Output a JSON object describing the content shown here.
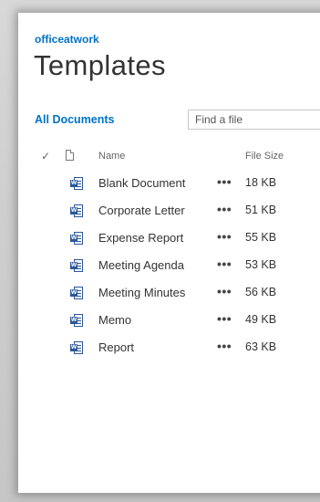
{
  "site": {
    "name": "officeatwork"
  },
  "page": {
    "title": "Templates"
  },
  "view": {
    "label": "All Documents"
  },
  "search": {
    "placeholder": "Find a file"
  },
  "columns": {
    "check": "✓",
    "type_icon": "document-icon",
    "name": "Name",
    "size": "File Size"
  },
  "row_menu_label": "•••",
  "files": [
    {
      "name": "Blank Document",
      "size": "18 KB",
      "icon": "word-icon"
    },
    {
      "name": "Corporate Letter",
      "size": "51 KB",
      "icon": "word-icon"
    },
    {
      "name": "Expense Report",
      "size": "55 KB",
      "icon": "word-icon"
    },
    {
      "name": "Meeting Agenda",
      "size": "53 KB",
      "icon": "word-icon"
    },
    {
      "name": "Meeting Minutes",
      "size": "56 KB",
      "icon": "word-icon"
    },
    {
      "name": "Memo",
      "size": "49 KB",
      "icon": "word-icon"
    },
    {
      "name": "Report",
      "size": "63 KB",
      "icon": "word-icon"
    }
  ],
  "colors": {
    "accent": "#0072c6",
    "word_blue": "#2b5797",
    "text": "#333333"
  }
}
